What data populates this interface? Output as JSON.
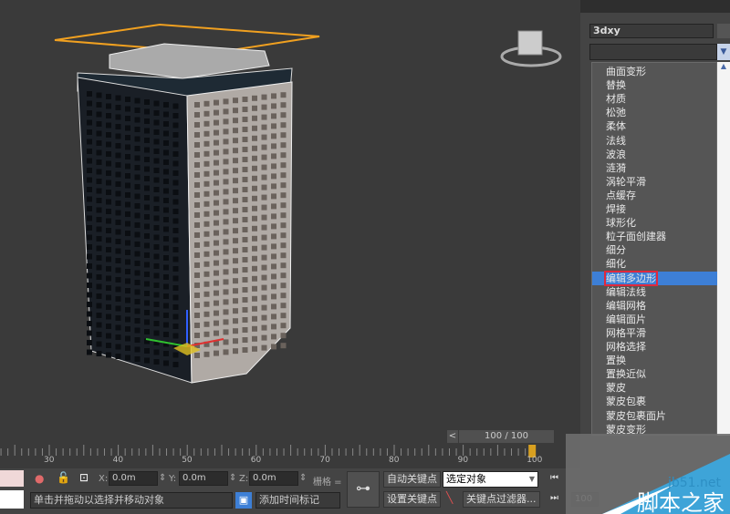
{
  "panel": {
    "object_name": "3dxy",
    "modifier_list": [
      "曲面变形",
      "替换",
      "材质",
      "松弛",
      "柔体",
      "法线",
      "波浪",
      "涟漪",
      "涡轮平滑",
      "点缓存",
      "焊接",
      "球形化",
      "粒子面创建器",
      "细分",
      "细化",
      "编辑多边形",
      "编辑法线",
      "编辑网格",
      "编辑面片",
      "网格平滑",
      "网格选择",
      "置换",
      "置换近似",
      "蒙皮",
      "蒙皮包裹",
      "蒙皮包裹面片",
      "蒙皮变形"
    ],
    "selected_index": 15
  },
  "timeline": {
    "frame_display": "100 / 100",
    "prev": "<",
    "labels": [
      "30",
      "40",
      "50",
      "60",
      "70",
      "80",
      "90",
      "100"
    ],
    "current_frame": 100
  },
  "status": {
    "x_label": "X:",
    "x": "0.0m",
    "y_label": "Y:",
    "y": "0.0m",
    "z_label": "Z:",
    "z": "0.0m",
    "grid": "栅格 =",
    "prompt": "单击并拖动以选择并移动对象",
    "add_time_tag": "添加时间标记",
    "auto_key": "自动关键点",
    "set_key": "设置关键点",
    "key_mode": "选定对象",
    "key_filters": "关键点过滤器...",
    "frame_field": "100"
  },
  "watermark": {
    "site": "jb51.net",
    "name": "脚本之家"
  }
}
